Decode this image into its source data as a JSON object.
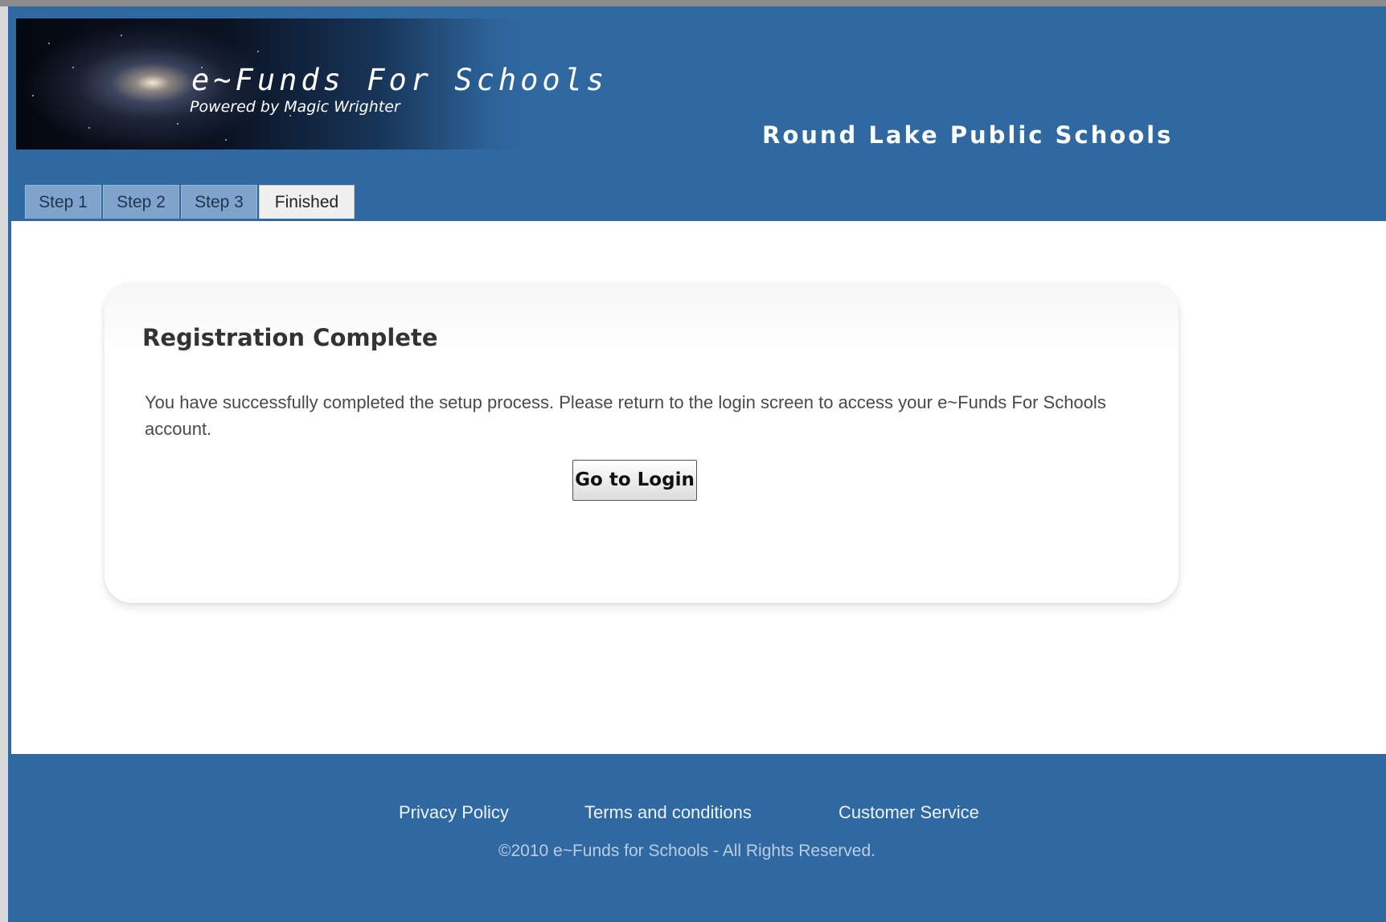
{
  "header": {
    "brand_title": "e~Funds For Schools",
    "brand_subtitle": "Powered by Magic Wrighter",
    "district_name": "Round Lake Public Schools"
  },
  "tabs": [
    {
      "label": "Step 1",
      "active": false
    },
    {
      "label": "Step 2",
      "active": false
    },
    {
      "label": "Step 3",
      "active": false
    },
    {
      "label": "Finished",
      "active": true
    }
  ],
  "main": {
    "title": "Registration Complete",
    "message": "You have successfully completed the setup process. Please return to the login screen to access your e~Funds For Schools account.",
    "login_button": "Go to Login"
  },
  "footer": {
    "links": [
      "Privacy Policy",
      "Terms and conditions",
      "Customer Service"
    ],
    "copyright": "©2010 e~Funds for Schools - All Rights Reserved."
  },
  "colors": {
    "brand_blue": "#3069a2",
    "tab_inactive": "#7fa3cb",
    "tab_active": "#f0f0f0"
  }
}
